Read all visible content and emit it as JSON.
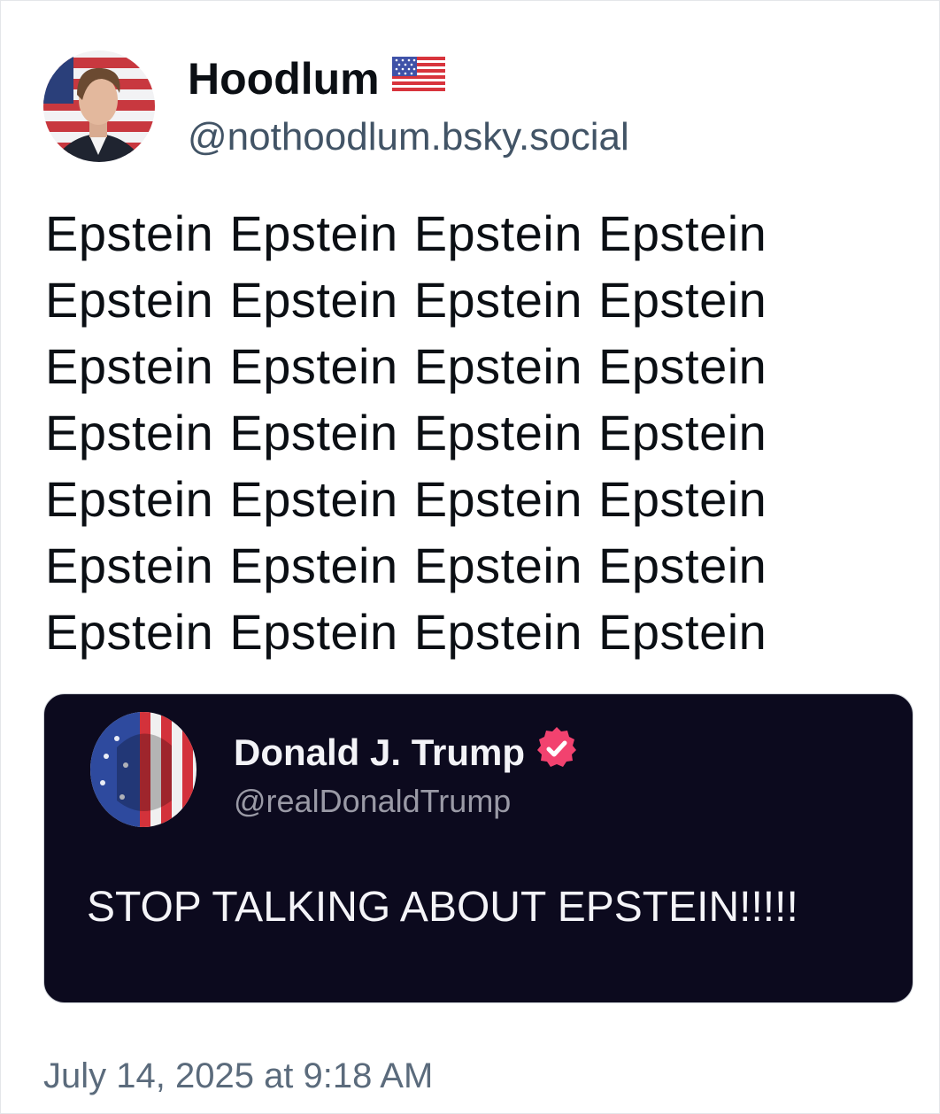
{
  "author": {
    "display_name": "Hoodlum",
    "flag_emoji_name": "us-flag-icon",
    "handle": "@nothoodlum.bsky.social"
  },
  "post": {
    "text": "Epstein Epstein Epstein Epstein Epstein Epstein Epstein Epstein Epstein Epstein Epstein Epstein Epstein Epstein Epstein Epstein Epstein Epstein Epstein Epstein Epstein Epstein Epstein Epstein Epstein Epstein Epstein Epstein"
  },
  "embed": {
    "display_name": "Donald J. Trump",
    "handle": "@realDonaldTrump",
    "text": "STOP TALKING ABOUT EPSTEIN!!!!!",
    "verified_icon": "verified-badge-icon",
    "background_color": "#0c0a1e",
    "badge_color": "#f2426f"
  },
  "timestamp": "July 14, 2025 at 9:18 AM"
}
